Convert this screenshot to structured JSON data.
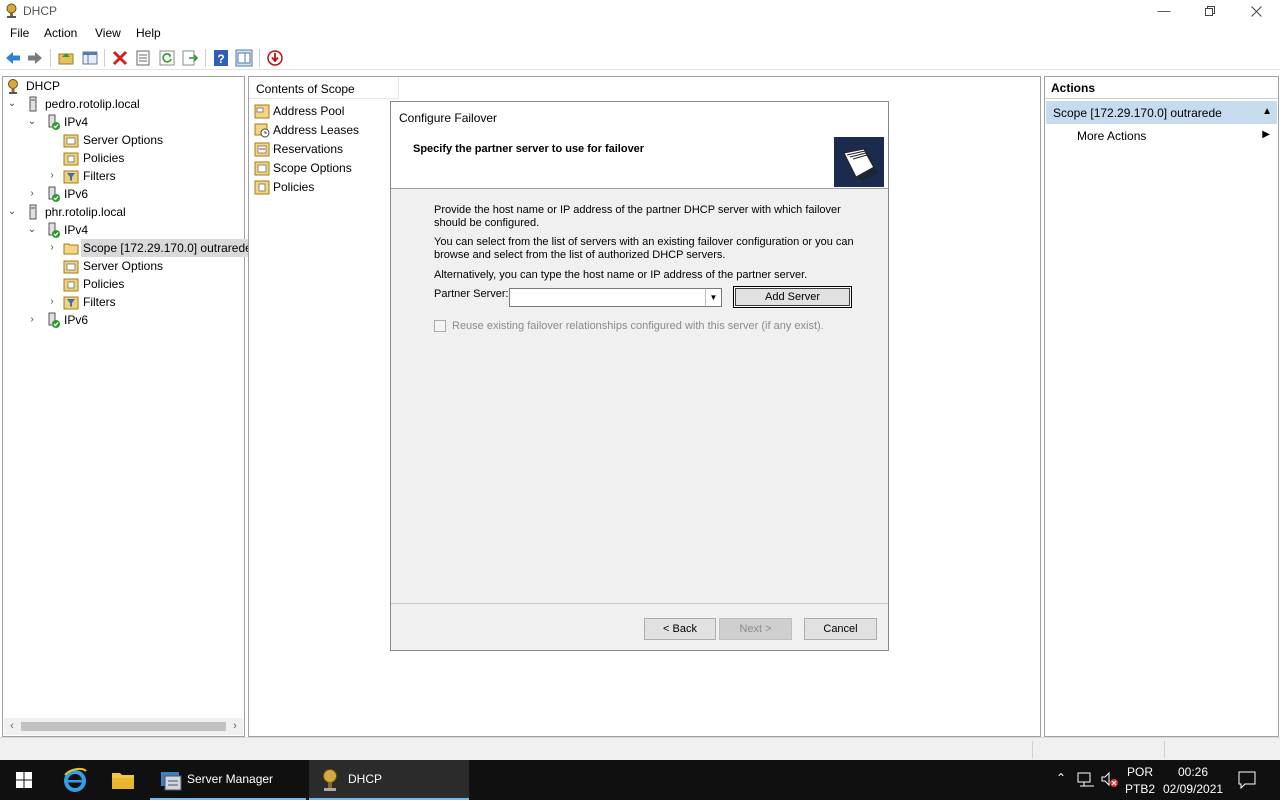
{
  "window": {
    "title": "DHCP",
    "min_icon": "minimize-icon",
    "restore_icon": "restore-icon",
    "close_icon": "close-icon"
  },
  "menu": [
    "File",
    "Action",
    "View",
    "Help"
  ],
  "tree": {
    "root": "DHCP",
    "server1": "pedro.rotolip.local",
    "s1_ipv4": "IPv4",
    "s1_server_options": "Server Options",
    "s1_policies": "Policies",
    "s1_filters": "Filters",
    "s1_ipv6": "IPv6",
    "server2": "phr.rotolip.local",
    "s2_ipv4": "IPv4",
    "s2_scope": "Scope [172.29.170.0] outrarede",
    "s2_server_options": "Server Options",
    "s2_policies": "Policies",
    "s2_filters": "Filters",
    "s2_ipv6": "IPv6"
  },
  "contents": {
    "header": "Contents of Scope",
    "items": [
      "Address Pool",
      "Address Leases",
      "Reservations",
      "Scope Options",
      "Policies"
    ]
  },
  "actions": {
    "title": "Actions",
    "scope": "Scope [172.29.170.0] outrarede",
    "more": "More Actions"
  },
  "dialog": {
    "title": "Configure Failover",
    "subtitle": "Specify the partner server to use for failover",
    "p1": "Provide the host name or IP address of the partner DHCP server with which failover should be configured.",
    "p2": "You can select from the list of servers with an existing failover configuration or you can browse and select from the list of authorized DHCP servers.",
    "p3": "Alternatively, you can type the host name or IP address of the partner server.",
    "partner_label": "Partner Server:",
    "partner_value": "",
    "add_server": "Add Server",
    "reuse": "Reuse existing failover relationships configured with this server (if any exist).",
    "reuse_checked": false,
    "back": "< Back",
    "next": "Next >",
    "cancel": "Cancel"
  },
  "taskbar": {
    "apps": [
      "Server Manager",
      "DHCP"
    ],
    "lang1": "POR",
    "lang2": "PTB2",
    "time": "00:26",
    "date": "02/09/2021"
  },
  "colors": {
    "selection": "#c6dbee",
    "taskbar": "#101010",
    "accent": "#76b9ed"
  }
}
